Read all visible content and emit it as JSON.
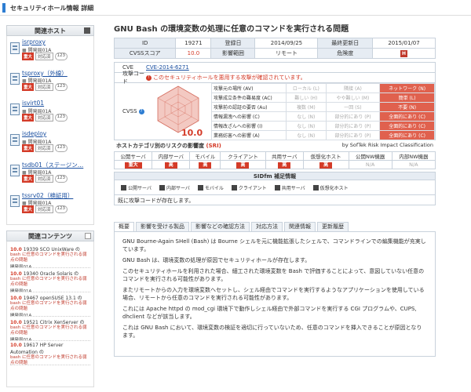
{
  "header": {
    "title": "セキュリティホール情報 詳細"
  },
  "sidebar": {
    "hosts_title": "関連ホスト",
    "hosts": [
      {
        "name": "isrproxy",
        "group": "開発局01A",
        "level": "重大",
        "status": "対応済",
        "count": "123"
      },
      {
        "name": "tsproxy（外線）",
        "group": "開発局01A",
        "level": "重大",
        "status": "対応済",
        "count": "123"
      },
      {
        "name": "isvirt01",
        "group": "開発局01A",
        "level": "重大",
        "status": "対応済",
        "count": "123"
      },
      {
        "name": "isdeploy",
        "group": "開発局01A",
        "level": "重大",
        "status": "対応済",
        "count": "123"
      },
      {
        "name": "tsdb01（ステージン…",
        "group": "開発局01A",
        "level": "重大",
        "status": "対応済",
        "count": "123"
      },
      {
        "name": "tssrv02（検証用）",
        "group": "開発局01A",
        "level": "重大",
        "status": "対応済",
        "count": "123"
      }
    ],
    "contents_title": "関連コンテンツ",
    "contents": [
      {
        "score": "10.0",
        "id_title": "19339 SCO UnixWare の",
        "desc": "bash に任意のコマンドを実行される弱点の問題",
        "group": "開発局01A"
      },
      {
        "score": "10.0",
        "id_title": "19340 Oracle Solaris の",
        "desc": "bash に任意のコマンドを実行される弱点の問題",
        "group": "開発局01A"
      },
      {
        "score": "10.0",
        "id_title": "19467 openSUSE 13.1 の",
        "desc": "bash に任意のコマンドを実行される弱点の問題",
        "group": "開発局01A"
      },
      {
        "score": "10.0",
        "id_title": "19521 Citrix XenServer の",
        "desc": "bash に任意のコマンドを実行される弱点の問題",
        "group": "開発局01A"
      },
      {
        "score": "10.0",
        "id_title": "19617 HP Server Automation の",
        "desc": "bash に任意のコマンドを実行される弱点の問題",
        "group": "開発局01A"
      }
    ]
  },
  "main": {
    "title": "GNU Bash の環境変数の処理に任意のコマンドを実行される問題",
    "info": {
      "id_label": "ID",
      "id_value": "19271",
      "registered_label": "登録日",
      "registered_value": "2014/09/25",
      "updated_label": "最終更新日",
      "updated_value": "2015/01/07",
      "cvss_label": "CVSSスコア",
      "cvss_value": "10.0",
      "impact_label": "影響範囲",
      "impact_value": "リモート",
      "severity_label": "危険度",
      "severity_value": "H"
    },
    "cve_label": "CVE",
    "cve_value": "CVE-2014-6271",
    "attack_label": "攻撃コード",
    "attack_text": "このセキュリティホールを悪用する攻撃が確認されています。",
    "cvss_label": "CVSS",
    "cvss_score": "10.0",
    "metrics": [
      {
        "name": "攻撃元の場所 (AV)",
        "options": [
          "ローカル (L)",
          "隣接 (A)",
          "ネットワーク (N)"
        ],
        "selected": 2
      },
      {
        "name": "攻撃成立条件の難易度 (AC)",
        "options": [
          "難しい (H)",
          "やや難しい (M)",
          "簡単 (L)"
        ],
        "selected": 2
      },
      {
        "name": "攻撃前の認証の要否 (Au)",
        "options": [
          "複数 (M)",
          "一回 (S)",
          "不要 (N)"
        ],
        "selected": 2
      },
      {
        "name": "情報漏洩への影響 (C)",
        "options": [
          "なし (N)",
          "部分的にあり (P)",
          "全面的にあり (C)"
        ],
        "selected": 2
      },
      {
        "name": "情報改ざんへの影響 (I)",
        "options": [
          "なし (N)",
          "部分的にあり (P)",
          "全面的にあり (C)"
        ],
        "selected": 2
      },
      {
        "name": "業務妨害への影響 (A)",
        "options": [
          "なし (N)",
          "部分的にあり (P)",
          "全面的にあり (C)"
        ],
        "selected": 2
      }
    ],
    "risk": {
      "title_prefix": "ホストカテゴリ別のリスクの影響度",
      "title_sri": "(SRI)",
      "brand": "by SofTek Risk Impact Classification",
      "headers": [
        "公開サーバ",
        "内部サーバ",
        "モバイル",
        "クライアント",
        "共用サーバ",
        "仮想化ホスト",
        "公開NW機器",
        "内部NW機器"
      ],
      "values": [
        "重大",
        "高",
        "高",
        "高",
        "高",
        "高",
        "N/A",
        "N/A"
      ]
    },
    "sidfm": {
      "title": "SIDfm 補足情報",
      "icons": [
        "公開サーバ",
        "内部サーバ",
        "モバイル",
        "クライアント",
        "共用サーバ",
        "仮想化ホスト"
      ],
      "note": "既に攻撃コードが存在します。"
    },
    "tabs": [
      "概要",
      "影響を受ける製品",
      "影響などの確認方法",
      "対応方法",
      "関連情報",
      "更新履歴"
    ],
    "description": [
      "GNU Bourne-Again SHell (Bash) は Bourne シェルを元に機能拡張したシェルで、コマンドラインでの編集機能が充実しています。",
      "GNU Bash は、環境変数の処理が原因でセキュリティホールが存在します。",
      "このセキュリティホールを利用された場合、細工された環境変数を Bash で評価することによって、意図していない任意のコマンドを実行される可能性があります。",
      "またリモートからの入力を環境変数へセットし、シェル経由でコマンドを実行するようなアプリケーションを使用している場合、リモートから任意のコマンドを実行される可能性があります。",
      "これには Apache httpd の mod_cgi 環境下で動作しシェル経由で外部コマンドを実行する CGI プログラムや、CUPS, dhclient などが該当します。",
      "これは GNU Bash において、環境変数の検証を適切に行っていないため、任意のコマンドを挿入できることが原因となります。"
    ]
  }
}
